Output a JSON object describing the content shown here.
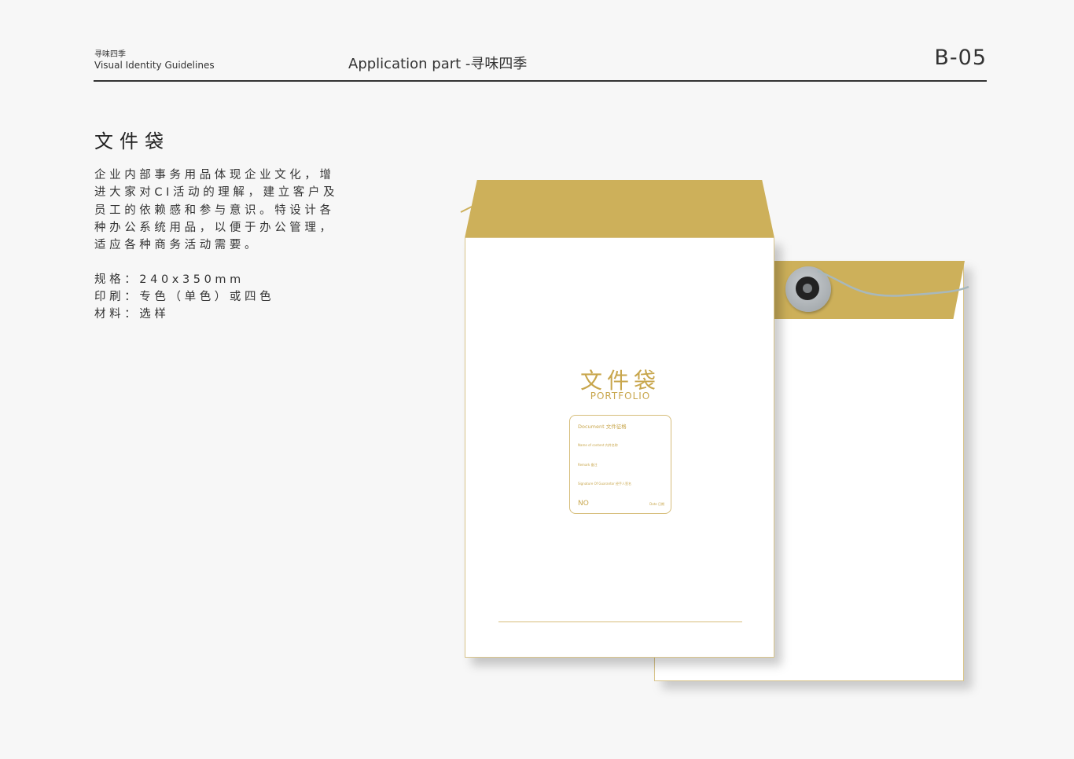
{
  "header": {
    "brand_cn": "寻味四季",
    "brand_en": "Visual Identity Guidelines",
    "section": "Application part -寻味四季",
    "page_code": "B-05"
  },
  "content": {
    "title": "文件袋",
    "description": "企业内部事务用品体现企业文化，增进大家对CI活动的理解，建立客户及员工的依赖感和参与意识。特设计各种办公系统用品，以便于办公管理，适应各种商务活动需要。",
    "specs": [
      "规格：240x350mm",
      "印刷：专色（单色）或四色",
      "材料：选样"
    ]
  },
  "envelope": {
    "title_cn": "文件袋",
    "title_en": "PORTFOLIO",
    "label": {
      "document": "Document  文件征格",
      "name": "Name of content  内件名称",
      "remark": "Remark  备注",
      "signature": "Signature Of Guarantor  经手人签名",
      "no": "NO",
      "date": "Date  日期"
    }
  },
  "colors": {
    "flap": "#cdb05a",
    "accent_text": "#c8a64c",
    "background": "#f7f7f7"
  }
}
